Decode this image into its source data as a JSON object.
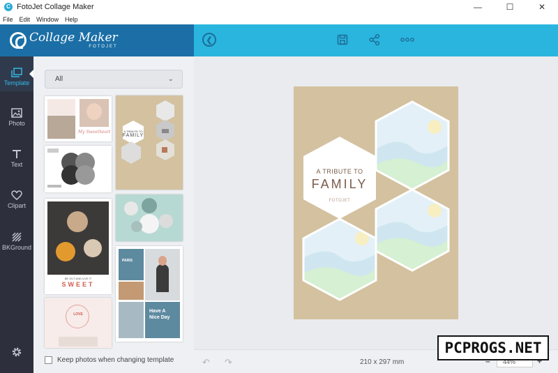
{
  "window": {
    "title": "FotoJet Collage Maker",
    "minimize": "—",
    "maximize": "☐",
    "close": "✕"
  },
  "menu": [
    "File",
    "Edit",
    "Window",
    "Help"
  ],
  "header": {
    "logo_main": "Collage Maker",
    "logo_sub": "FOTOJET",
    "back_icon": "back-arrow-icon",
    "save_icon": "save-icon",
    "share_icon": "share-icon",
    "more_icon": "more-icon"
  },
  "nav": [
    {
      "label": "Template",
      "icon": "template-icon",
      "active": true
    },
    {
      "label": "Photo",
      "icon": "photo-icon",
      "active": false
    },
    {
      "label": "Text",
      "icon": "text-icon",
      "active": false
    },
    {
      "label": "Clipart",
      "icon": "heart-icon",
      "active": false
    },
    {
      "label": "BKGround",
      "icon": "background-icon",
      "active": false
    }
  ],
  "panel": {
    "dropdown_value": "All",
    "keep_photos_label": "Keep photos when changing template",
    "keep_photos_checked": false
  },
  "templates": {
    "t1": {
      "script": "My Sweetheart"
    },
    "t2": {
      "line1": "A TRIBUTE TO",
      "line2": "FAMILY"
    },
    "t5": {
      "line1": "BE OUT AND LIVE IT",
      "line2": "SWEET"
    },
    "t6": {
      "city1": "PARIS",
      "text1": "Have A",
      "text2": "Nice Day"
    },
    "t7": {
      "text": "LOVE"
    }
  },
  "canvas": {
    "tribute_line1": "A TRIBUTE TO",
    "tribute_line2": "FAMILY",
    "brand": "FOTOJET",
    "bg_color": "#d3c1a0"
  },
  "footer": {
    "size": "210 x 297 mm",
    "zoom": "44%",
    "zoom_minus": "–",
    "zoom_plus": "+"
  },
  "watermark": "PCPROGS.NET",
  "colors": {
    "header_dark": "#1b6fa6",
    "header_light": "#2ab5de",
    "nav_bg": "#2d2f3c",
    "accent": "#35b8e3"
  }
}
